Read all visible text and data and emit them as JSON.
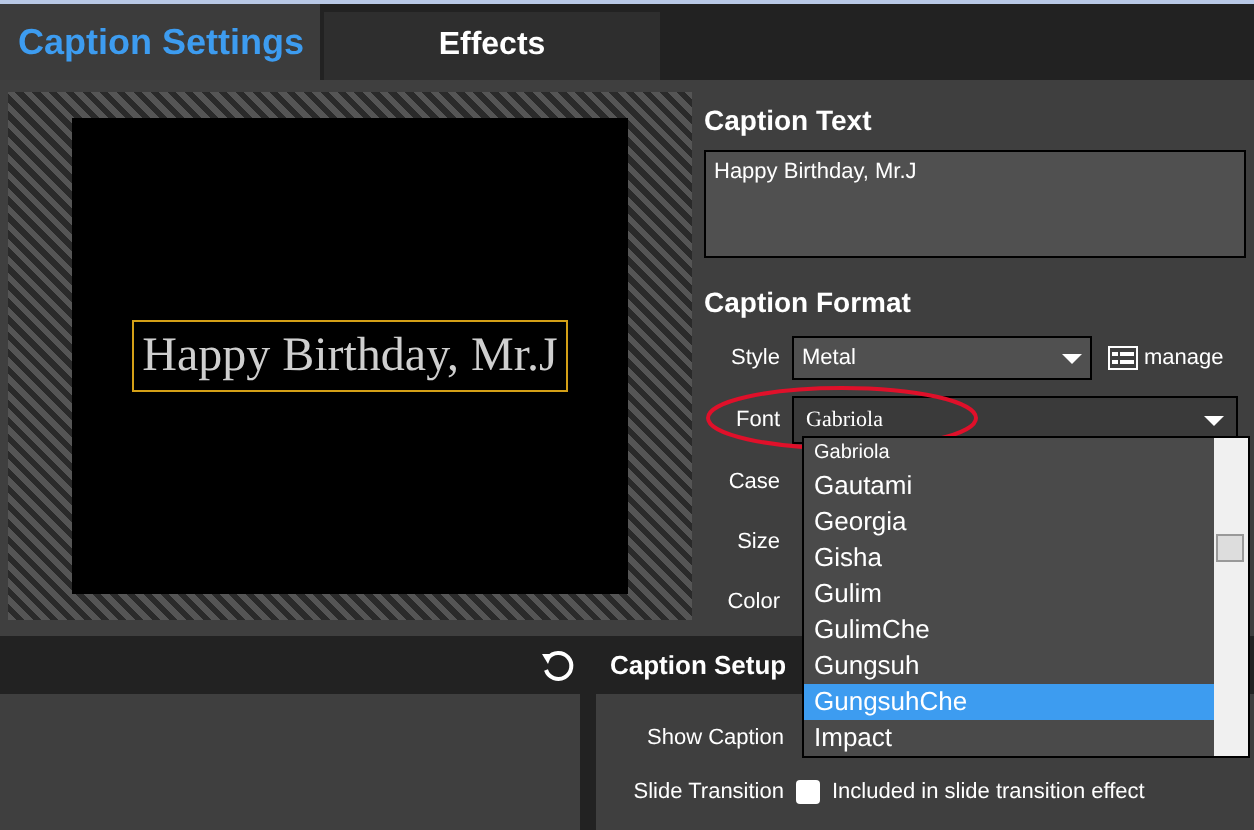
{
  "tabs": [
    {
      "label": "Caption Settings",
      "selected": true
    },
    {
      "label": "Effects",
      "selected": false
    }
  ],
  "preview": {
    "caption": "Happy Birthday, Mr.J"
  },
  "caption_text": {
    "heading": "Caption Text",
    "value": "Happy Birthday, Mr.J"
  },
  "caption_format": {
    "heading": "Caption Format",
    "style": {
      "label": "Style",
      "value": "Metal",
      "manage": "manage"
    },
    "font": {
      "label": "Font",
      "value": "Gabriola"
    },
    "labels": [
      "Case",
      "Size",
      "Color"
    ]
  },
  "font_list": [
    {
      "label": "Gabriola",
      "selected": false
    },
    {
      "label": "Gautami",
      "selected": false
    },
    {
      "label": "Georgia",
      "selected": false
    },
    {
      "label": "Gisha",
      "selected": false
    },
    {
      "label": "Gulim",
      "selected": false
    },
    {
      "label": "GulimChe",
      "selected": false
    },
    {
      "label": "Gungsuh",
      "selected": false
    },
    {
      "label": "GungsuhChe",
      "selected": true
    },
    {
      "label": "Impact",
      "selected": false
    }
  ],
  "caption_setup": {
    "title": "Caption Setup",
    "show_caption": "Show Caption",
    "slide_transition": "Slide Transition",
    "included": {
      "label": "Included in slide transition effect",
      "checked": false
    }
  }
}
